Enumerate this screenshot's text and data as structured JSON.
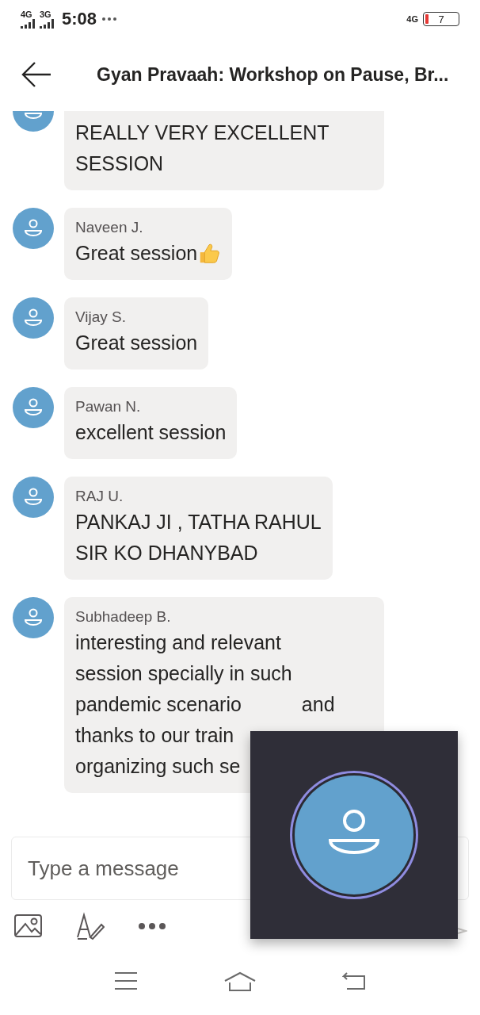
{
  "status_bar": {
    "sim_1": "4G",
    "sim_2": "3G",
    "time": "5:08",
    "network": "4G",
    "battery": "7"
  },
  "header": {
    "title": "Gyan Pravaah: Workshop on Pause, Br..."
  },
  "messages": [
    {
      "lines": [
        [
          "REALLY VERY EXCELLENT"
        ],
        [
          "SESSION"
        ]
      ]
    },
    {
      "author": "Naveen J.",
      "lines": [
        [
          "Great session"
        ]
      ],
      "thumbs_up": true
    },
    {
      "author": "Vijay S.",
      "lines": [
        [
          "Great session"
        ]
      ]
    },
    {
      "author": "Pawan N.",
      "lines": [
        [
          "excellent session"
        ]
      ]
    },
    {
      "author": "RAJ U.",
      "lines": [
        [
          "PANKAJ JI , TATHA RAHUL"
        ],
        [
          "SIR KO DHANYBAD"
        ]
      ]
    },
    {
      "author": "Subhadeep B.",
      "lines": [
        [
          "interesting and relevant"
        ],
        [
          "session specially in such"
        ],
        [
          "pandemic scenario",
          "and"
        ],
        [
          "thanks to our train"
        ],
        [
          "organizing such se"
        ]
      ]
    }
  ],
  "composer": {
    "placeholder": "Type a message"
  },
  "call_tile": {
    "kind": "avatar"
  }
}
